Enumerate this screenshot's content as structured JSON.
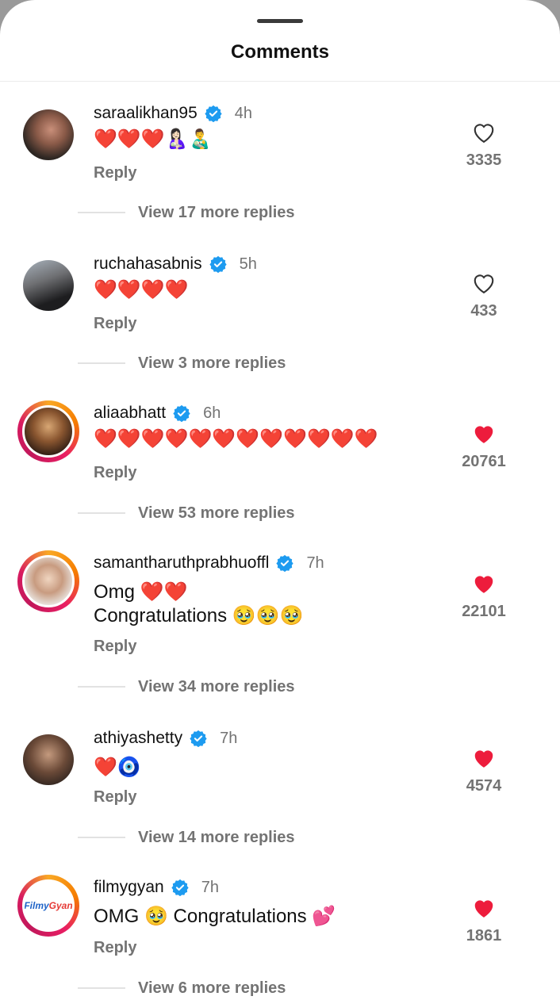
{
  "header": {
    "title": "Comments"
  },
  "colors": {
    "liked": "#ed1c3c",
    "verified": "#1d9bf0",
    "secondary": "#737373"
  },
  "comments": [
    {
      "username": "saraalikhan95",
      "time": "4h",
      "text": "❤️❤️❤️🤱🏻👨‍🍼",
      "reply": "Reply",
      "likes": "3335",
      "liked": false,
      "view_replies": "View 17 more replies"
    },
    {
      "username": "ruchahasabnis",
      "time": "5h",
      "text": "❤️❤️❤️❤️",
      "reply": "Reply",
      "likes": "433",
      "liked": false,
      "view_replies": "View 3 more replies"
    },
    {
      "username": "aliaabhatt",
      "time": "6h",
      "text": "❤️❤️❤️❤️❤️❤️❤️❤️❤️❤️❤️❤️",
      "reply": "Reply",
      "likes": "20761",
      "liked": true,
      "view_replies": "View 53 more replies"
    },
    {
      "username": "samantharuthprabhuoffl",
      "time": "7h",
      "text": "Omg ❤️❤️\nCongratulations 🥹🥹🥹",
      "reply": "Reply",
      "likes": "22101",
      "liked": true,
      "view_replies": "View 34 more replies"
    },
    {
      "username": "athiyashetty",
      "time": "7h",
      "text": "❤️🧿",
      "reply": "Reply",
      "likes": "4574",
      "liked": true,
      "view_replies": "View 14 more replies"
    },
    {
      "username": "filmygyan",
      "time": "7h",
      "text": "OMG 🥹 Congratulations 💕",
      "reply": "Reply",
      "likes": "1861",
      "liked": true,
      "view_replies": "View 6 more replies",
      "avatar_text": [
        "Filmy",
        "Gyan"
      ]
    }
  ]
}
